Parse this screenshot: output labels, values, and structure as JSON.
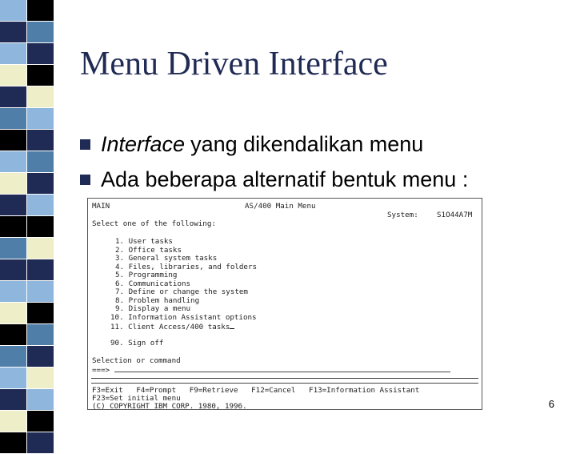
{
  "slide": {
    "title": "Menu Driven Interface",
    "page_number": "6",
    "bullets": [
      {
        "em": "Interface",
        "text": "yang dikendalikan menu"
      },
      {
        "em": "",
        "text": "Ada beberapa alternatif bentuk menu :"
      }
    ]
  },
  "terminal": {
    "menu_id": "MAIN",
    "screen_title": "AS/400 Main Menu",
    "system_label": "System:",
    "system_value": "S1O44A7M",
    "prompt": "Select one of the following:",
    "options": [
      "1. User tasks",
      "2. Office tasks",
      "3. General system tasks",
      "4. Files, libraries, and folders",
      "5. Programming",
      "6. Communications",
      "7. Define or change the system",
      "8. Problem handling",
      "9. Display a menu",
      "10. Information Assistant options",
      "11. Client Access/400 tasks"
    ],
    "signoff": "90. Sign off",
    "command_label": "Selection or command",
    "command_prompt": "===>",
    "fkeys_1": "F3=Exit   F4=Prompt   F9=Retrieve   F12=Cancel   F13=Information Assistant",
    "fkeys_2": "F23=Set initial menu",
    "copyright": "(C) COPYRIGHT IBM CORP. 1980, 1996."
  },
  "colors": {
    "title": "#1f2a55",
    "bullet_mark": "#1f2a55",
    "strip_navy": "#1f2a55",
    "strip_slate": "#4f7fa8",
    "strip_sky": "#8fb6dc",
    "strip_cream": "#eeeec8"
  }
}
